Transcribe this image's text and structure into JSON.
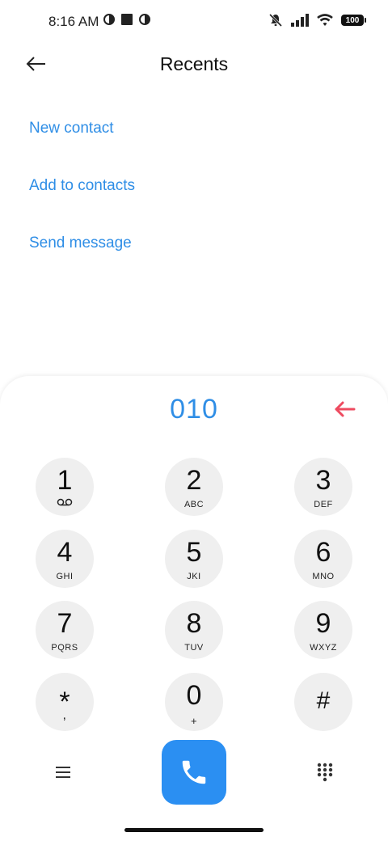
{
  "status_bar": {
    "time": "8:16 AM",
    "battery": "100"
  },
  "header": {
    "title": "Recents"
  },
  "actions": {
    "new_contact": "New contact",
    "add_to_contacts": "Add to contacts",
    "send_message": "Send message"
  },
  "dialer": {
    "number": "010",
    "keys": [
      {
        "digit": "1",
        "letters": ""
      },
      {
        "digit": "2",
        "letters": "ABC"
      },
      {
        "digit": "3",
        "letters": "DEF"
      },
      {
        "digit": "4",
        "letters": "GHI"
      },
      {
        "digit": "5",
        "letters": "JKI"
      },
      {
        "digit": "6",
        "letters": "MNO"
      },
      {
        "digit": "7",
        "letters": "PQRS"
      },
      {
        "digit": "8",
        "letters": "TUV"
      },
      {
        "digit": "9",
        "letters": "WXYZ"
      },
      {
        "digit": "*",
        "letters": ","
      },
      {
        "digit": "0",
        "letters": "+"
      },
      {
        "digit": "#",
        "letters": ""
      }
    ]
  },
  "icons": {
    "back": "back-arrow-icon",
    "backspace": "backspace-arrow-icon",
    "voicemail": "voicemail-icon",
    "menu": "menu-icon",
    "call": "phone-icon",
    "keypad": "dialpad-icon"
  },
  "colors": {
    "accent": "#2f8ee6",
    "call_button": "#2b8ff2",
    "backspace": "#ee4b60",
    "key_background": "#efefef"
  }
}
